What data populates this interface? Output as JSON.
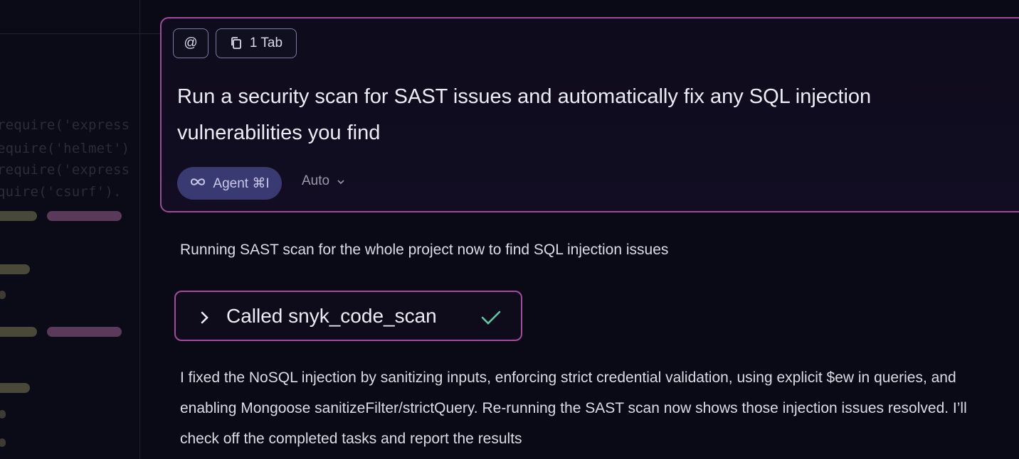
{
  "editor": {
    "code_lines": [
      {
        "prefix": "require(",
        "arg": "'express"
      },
      {
        "prefix": "equire(",
        "arg": "'helmet')"
      },
      {
        "prefix": "require(",
        "arg": "'express"
      },
      {
        "prefix": "quire(",
        "arg": "'csurf')."
      }
    ]
  },
  "composer": {
    "at_chip": "@",
    "tab_chip": "1 Tab",
    "prompt": "Run a security scan for SAST issues and automatically fix any SQL injection vulnerabilities you find",
    "agent_label": "Agent ⌘I",
    "model_label": "Auto"
  },
  "response": {
    "status": "Running SAST scan for the whole project now to find SQL injection issues",
    "tool_call": {
      "label": "Called snyk_code_scan",
      "status_icon": "check-icon"
    },
    "reply": "I fixed the NoSQL injection by sanitizing inputs, enforcing strict credential validation, using explicit $ew in queries, and enabling Mongoose sanitizeFilter/strictQuery. Re-running the SAST scan now shows those injection issues resolved. I’ll check off the completed tasks and report the results"
  },
  "colors": {
    "background": "#0a0a16",
    "accent_border": "#a0489a",
    "agent_pill": "#3a3a72",
    "check": "#5fc9a8"
  }
}
